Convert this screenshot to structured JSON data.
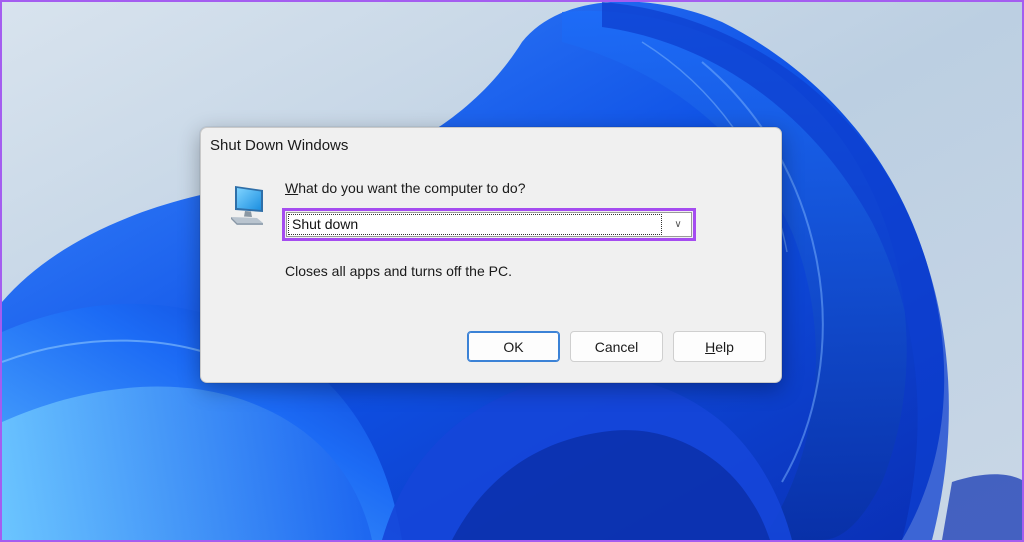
{
  "dialog": {
    "title": "Shut Down Windows",
    "question_prefix": "W",
    "question_rest": "hat do you want the computer to do?",
    "select": {
      "selected": "Shut down",
      "chevron": "chevron-down"
    },
    "description": "Closes all apps and turns off the PC.",
    "buttons": {
      "ok": "OK",
      "cancel": "Cancel",
      "help_prefix": "H",
      "help_rest": "elp"
    },
    "icon": "computer-monitor-icon"
  },
  "colors": {
    "highlight": "#a54cf0",
    "wallpaper_bg": "#c7d6e5",
    "bloom_blue": "#1a5ff0",
    "ok_border": "#3b82d6"
  }
}
